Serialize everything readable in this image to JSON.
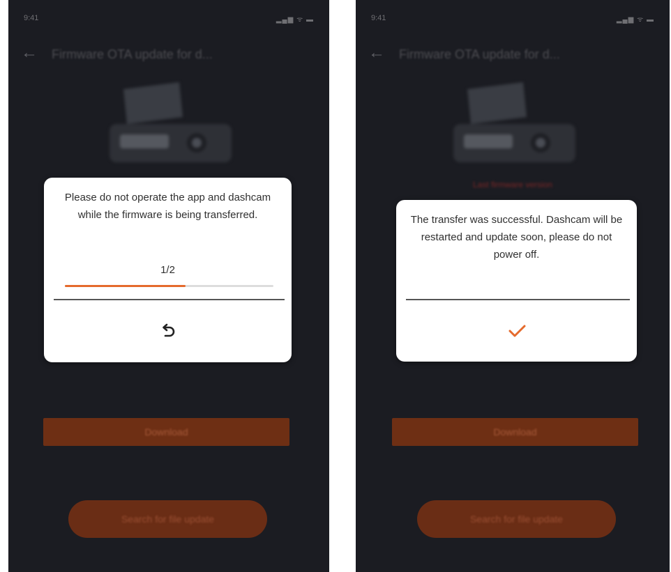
{
  "screens": [
    {
      "status_time": "9:41",
      "status_icons": "▂▄▆ ᯤ ▬",
      "header_title": "Firmware OTA update for d...",
      "device_caption": "",
      "dialog": {
        "message": "Please do not operate the app and dashcam while the firmware is being transferred.",
        "progress_text": "1/2",
        "progress_fraction": 0.58,
        "action_icon": "undo-icon"
      },
      "primary_button_label": "Download",
      "secondary_button_label": "Search for file update"
    },
    {
      "status_time": "9:41",
      "status_icons": "▂▄▆ ᯤ ▬",
      "header_title": "Firmware OTA update for d...",
      "device_caption": "Last firmware version",
      "dialog": {
        "message": "The transfer was successful. Dashcam will be restarted and update soon, please do not power off.",
        "action_icon": "checkmark-icon",
        "action_color": "#e56a2c"
      },
      "primary_button_label": "Download",
      "secondary_button_label": "Search for file update"
    }
  ],
  "colors": {
    "background": "#1b1c22",
    "accent": "#e56a2c",
    "button_dim": "#6e2f14"
  }
}
